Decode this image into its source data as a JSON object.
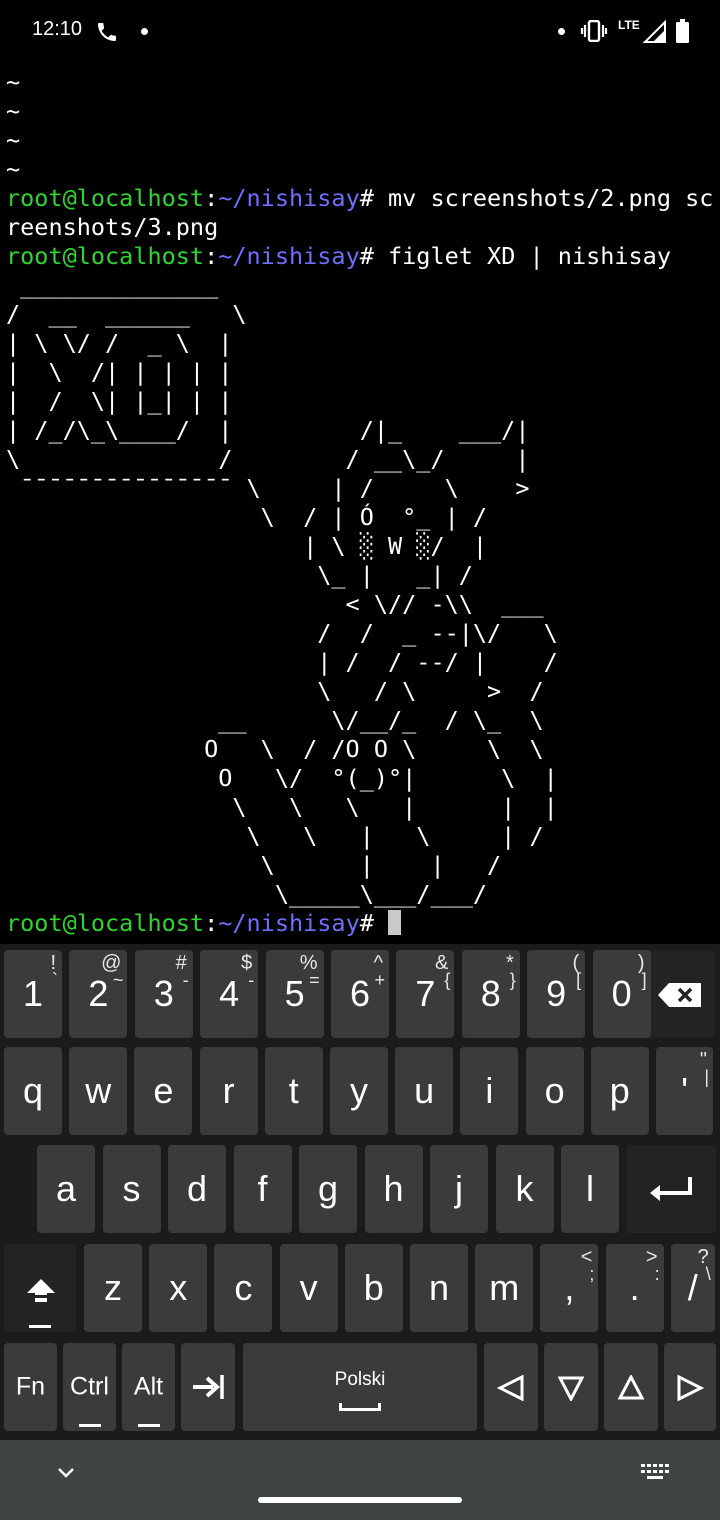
{
  "status_bar": {
    "time": "12:10",
    "network": "LTE"
  },
  "terminal": {
    "lines": [
      {
        "text": "~"
      },
      {
        "text": "~"
      },
      {
        "text": "~"
      },
      {
        "text": "~"
      },
      {
        "user": "root@localhost",
        "sep": ":",
        "path": "~/nishisay",
        "cmd": "# mv screenshots/2.png sc"
      },
      {
        "text": "reenshots/3.png"
      },
      {
        "user": "root@localhost",
        "sep": ":",
        "path": "~/nishisay",
        "cmd": "# figlet XD | nishisay"
      },
      {
        "text": " ______________"
      },
      {
        "text": "/  __  ______   \\"
      },
      {
        "text": "| \\ \\/ /  _ \\  |"
      },
      {
        "text": "|  \\  /| | | | |"
      },
      {
        "text": "|  /  \\| |_| | |"
      },
      {
        "text": "| /_/\\_\\____/  |         /|_    ___/|"
      },
      {
        "text": "\\              /        / __\\_/     |"
      },
      {
        "text": " ¯¯¯¯¯¯¯¯¯¯¯¯¯¯¯ \\     | /     \\    >"
      },
      {
        "text": "                  \\  / | Ó  °_ | /"
      },
      {
        "text": "                     | \\ ░ W ░/  |"
      },
      {
        "text": "                      \\_ |   _| /"
      },
      {
        "text": "                        < \\// -\\\\  ___"
      },
      {
        "text": "                      /  /  _ --|\\/   \\"
      },
      {
        "text": "                      | /  / --/ |    /"
      },
      {
        "text": "                      \\   / \\     >  /"
      },
      {
        "text": "               __      \\/__/_  / \\_  \\"
      },
      {
        "text": "              O   \\  / /O O \\     \\  \\"
      },
      {
        "text": "               O   \\/  °(_)°|      \\  |"
      },
      {
        "text": "                \\   \\   \\   |      |  |"
      },
      {
        "text": "                 \\   \\   |   \\     | /"
      },
      {
        "text": "                  \\      |    |   /"
      },
      {
        "text": "                   \\_____\\___/___/"
      },
      {
        "user": "root@localhost",
        "sep": ":",
        "path": "~/nishisay",
        "cmd": "# ",
        "cursor": true
      }
    ]
  },
  "keyboard": {
    "row1": [
      {
        "label": "1",
        "alt": "!",
        "alt2": "`"
      },
      {
        "label": "2",
        "alt": "@",
        "alt2": "~"
      },
      {
        "label": "3",
        "alt": "#",
        "alt2": "-"
      },
      {
        "label": "4",
        "alt": "$",
        "alt2": "-"
      },
      {
        "label": "5",
        "alt": "%",
        "alt2": "="
      },
      {
        "label": "6",
        "alt": "^",
        "alt2": "+"
      },
      {
        "label": "7",
        "alt": "&",
        "alt2": "{"
      },
      {
        "label": "8",
        "alt": "*",
        "alt2": "}"
      },
      {
        "label": "9",
        "alt": "(",
        "alt2": "["
      },
      {
        "label": "0",
        "alt": ")",
        "alt2": "]"
      }
    ],
    "row2": [
      {
        "label": "q"
      },
      {
        "label": "w"
      },
      {
        "label": "e"
      },
      {
        "label": "r"
      },
      {
        "label": "t"
      },
      {
        "label": "y"
      },
      {
        "label": "u"
      },
      {
        "label": "i"
      },
      {
        "label": "o"
      },
      {
        "label": "p"
      },
      {
        "label": "'",
        "alt": "\"",
        "alt2": "|"
      }
    ],
    "row3": [
      {
        "label": "a"
      },
      {
        "label": "s"
      },
      {
        "label": "d"
      },
      {
        "label": "f"
      },
      {
        "label": "g"
      },
      {
        "label": "h"
      },
      {
        "label": "j"
      },
      {
        "label": "k"
      },
      {
        "label": "l"
      }
    ],
    "row4": [
      {
        "label": "z"
      },
      {
        "label": "x"
      },
      {
        "label": "c"
      },
      {
        "label": "v"
      },
      {
        "label": "b"
      },
      {
        "label": "n"
      },
      {
        "label": "m"
      },
      {
        "label": ",",
        "alt": "<",
        "alt2": ";"
      },
      {
        "label": ".",
        "alt": ">",
        "alt2": ":"
      },
      {
        "label": "/",
        "alt": "?",
        "alt2": "\\"
      }
    ],
    "row5": {
      "fn": "Fn",
      "ctrl": "Ctrl",
      "alt": "Alt",
      "space_language": "Polski"
    }
  }
}
